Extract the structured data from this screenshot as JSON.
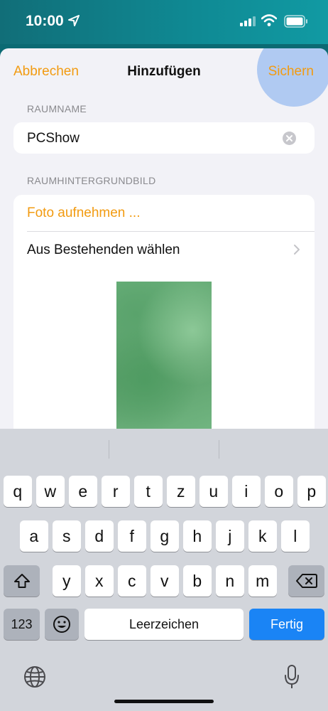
{
  "status_bar": {
    "time": "10:00"
  },
  "navbar": {
    "cancel_label": "Abbrechen",
    "title": "Hinzufügen",
    "save_label": "Sichern"
  },
  "room_name": {
    "section_label": "RAUMNAME",
    "value": "PCShow"
  },
  "background": {
    "section_label": "RAUMHINTERGRUNDBILD",
    "take_photo_label": "Foto aufnehmen ...",
    "choose_existing_label": "Aus Bestehenden wählen"
  },
  "keyboard": {
    "row1": [
      "q",
      "w",
      "e",
      "r",
      "t",
      "z",
      "u",
      "i",
      "o",
      "p"
    ],
    "row2": [
      "a",
      "s",
      "d",
      "f",
      "g",
      "h",
      "j",
      "k",
      "l"
    ],
    "row3": [
      "y",
      "x",
      "c",
      "v",
      "b",
      "n",
      "m"
    ],
    "numbers_label": "123",
    "space_label": "Leerzeichen",
    "return_label": "Fertig"
  },
  "colors": {
    "accent": "#f29b11",
    "return_key": "#1a84f5",
    "status_bar": "#0f8a94"
  }
}
